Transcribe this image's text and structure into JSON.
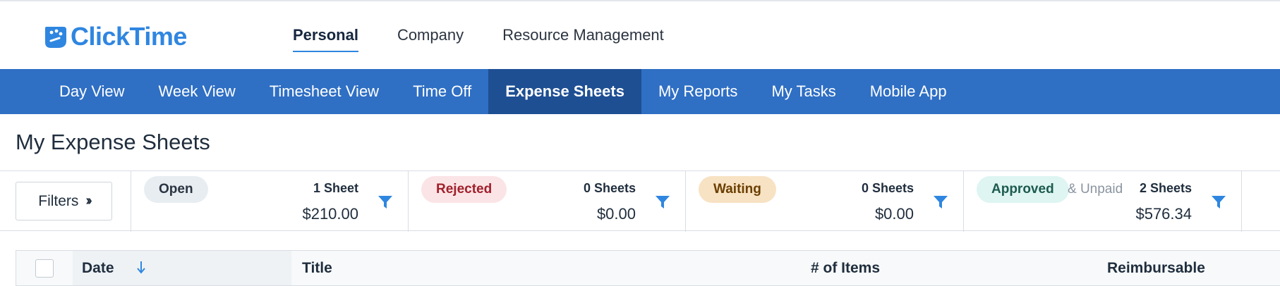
{
  "header": {
    "logo_text": "ClickTime",
    "nav": [
      {
        "label": "Personal",
        "active": true
      },
      {
        "label": "Company",
        "active": false
      },
      {
        "label": "Resource Management",
        "active": false
      }
    ]
  },
  "subnav": [
    {
      "label": "Day View"
    },
    {
      "label": "Week View"
    },
    {
      "label": "Timesheet View"
    },
    {
      "label": "Time Off"
    },
    {
      "label": "Expense Sheets",
      "active": true
    },
    {
      "label": "My Reports"
    },
    {
      "label": "My Tasks"
    },
    {
      "label": "Mobile App"
    }
  ],
  "page_title": "My Expense Sheets",
  "filters_label": "Filters",
  "statuses": [
    {
      "label": "Open",
      "count": "1 Sheet",
      "amount": "$210.00"
    },
    {
      "label": "Rejected",
      "count": "0 Sheets",
      "amount": "$0.00"
    },
    {
      "label": "Waiting",
      "count": "0 Sheets",
      "amount": "$0.00"
    },
    {
      "label": "Approved",
      "suffix": "& Unpaid",
      "count": "2 Sheets",
      "amount": "$576.34"
    }
  ],
  "table": {
    "columns": [
      "Date",
      "Title",
      "# of Items",
      "Reimbursable"
    ]
  },
  "colors": {
    "brand": "#2f86e0",
    "subnav_bg": "#2f6fc4",
    "subnav_active": "#1e4f93"
  }
}
